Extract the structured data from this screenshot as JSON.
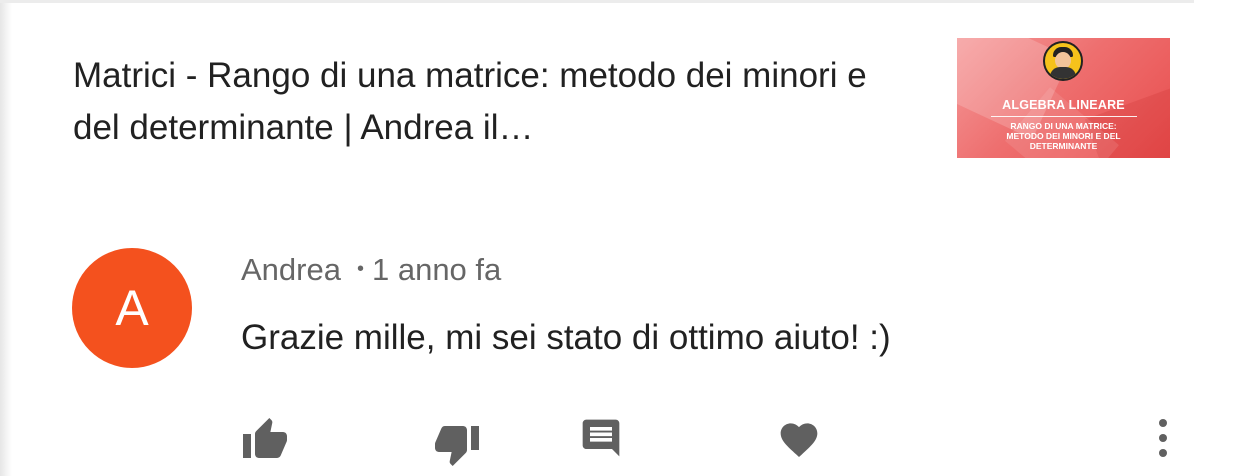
{
  "video": {
    "title": "Matrici - Rango di una matrice: metodo dei minori e del determinante | Andrea il…",
    "thumbnail": {
      "heading": "ALGEBRA LINEARE",
      "subtitle_line1": "RANGO DI UNA MATRICE:",
      "subtitle_line2": "METODO DEI MINORI E DEL",
      "subtitle_line3": "DETERMINANTE",
      "background_color": "#ee6f6f"
    }
  },
  "comment": {
    "avatar_letter": "A",
    "avatar_color": "#f4511e",
    "author": "Andrea",
    "separator": "•",
    "time": "1 anno fa",
    "text": "Grazie mille, mi sei stato di ottimo aiuto! :)"
  },
  "actions": {
    "like_icon": "thumb-up-icon",
    "dislike_icon": "thumb-down-icon",
    "reply_icon": "comment-icon",
    "heart_icon": "heart-icon",
    "more_icon": "more-vert-icon",
    "icon_color": "#606060"
  }
}
